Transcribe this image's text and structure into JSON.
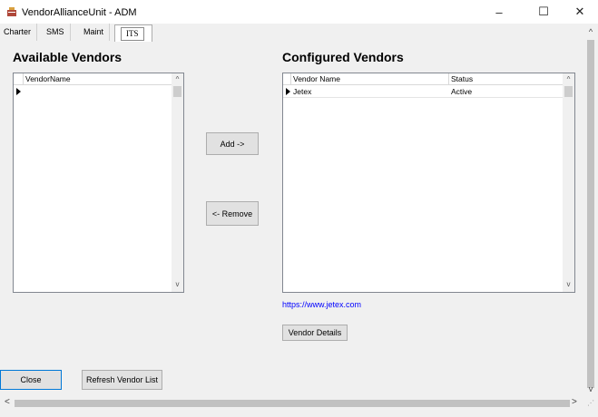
{
  "window": {
    "title": "VendorAllianceUnit - ADM",
    "minimize_glyph": "–",
    "maximize_glyph": "☐",
    "close_glyph": "✕",
    "icon": "app-icon"
  },
  "tabs": [
    {
      "label": "Charter",
      "selected": false
    },
    {
      "label": "SMS",
      "selected": false
    },
    {
      "label": "Maint",
      "selected": false
    },
    {
      "label": "ITS",
      "selected": true
    }
  ],
  "available_vendors": {
    "heading": "Available Vendors",
    "columns": [
      "VendorName"
    ],
    "rows": []
  },
  "configured_vendors": {
    "heading": "Configured Vendors",
    "columns": [
      "Vendor Name",
      "Status"
    ],
    "rows": [
      {
        "vendor_name": "Jetex",
        "status": "Active"
      }
    ]
  },
  "buttons": {
    "add": "Add ->",
    "remove": "<- Remove",
    "vendor_details": "Vendor Details",
    "close": "Close",
    "refresh": "Refresh Vendor List"
  },
  "vendor_link": "https://www.jetex.com",
  "glyphs": {
    "up": "^",
    "down": "v",
    "left": "<",
    "right": ">",
    "grip": "⋰"
  },
  "colors": {
    "accent": "#0078d7",
    "link": "#0000ff",
    "background": "#f0f0f0"
  }
}
